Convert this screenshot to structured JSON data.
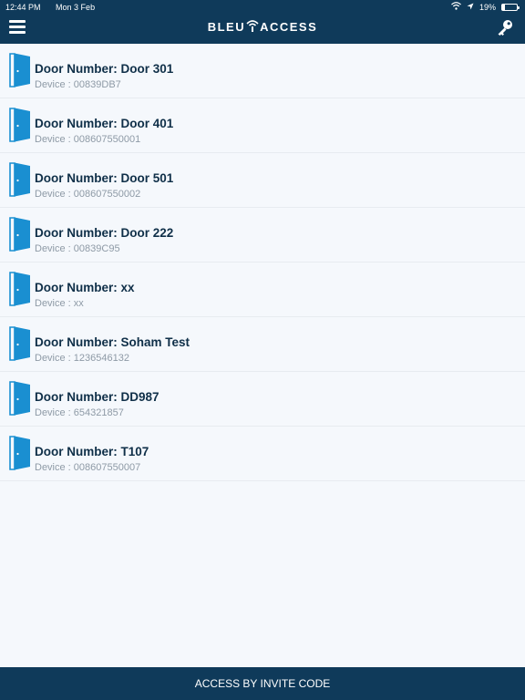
{
  "status_bar": {
    "time": "12:44 PM",
    "date": "Mon 3 Feb",
    "battery": "19%",
    "battery_level": 0.19,
    "icons": [
      "wifi-icon",
      "location-arrow-icon",
      "battery-icon"
    ]
  },
  "header": {
    "logo_text_left": "BLEU",
    "logo_text_right": "ACCESS",
    "menu_icon": "hamburger-menu-icon",
    "right_icon": "key-icon"
  },
  "colors": {
    "header_bg": "#0f3a5a",
    "door_blue": "#1a8fd1",
    "title_text": "#0f2f48",
    "sub_text": "#8e9aa6",
    "page_bg": "#f5f8fc"
  },
  "doors": [
    {
      "title": "Door Number: Door 301",
      "device": "Device : 00839DB7"
    },
    {
      "title": "Door Number: Door 401",
      "device": "Device : 008607550001"
    },
    {
      "title": "Door Number: Door 501",
      "device": "Device : 008607550002"
    },
    {
      "title": "Door Number: Door 222",
      "device": "Device : 00839C95"
    },
    {
      "title": "Door Number: xx",
      "device": "Device : xx"
    },
    {
      "title": "Door Number: Soham Test",
      "device": "Device : 1236546132"
    },
    {
      "title": "Door Number: DD987",
      "device": "Device : 654321857"
    },
    {
      "title": "Door Number: T107",
      "device": "Device : 008607550007"
    }
  ],
  "footer": {
    "button_label": "ACCESS BY INVITE CODE"
  }
}
